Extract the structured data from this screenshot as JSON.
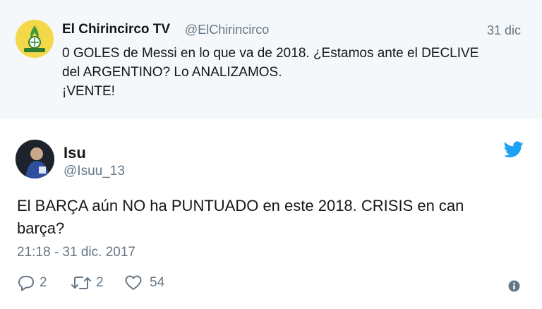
{
  "parent_tweet": {
    "author_name": "El Chirincirco TV",
    "author_handle": "@ElChirincirco",
    "date": "31 dic",
    "text_lines": [
      "0 GOLES de Messi en lo que va de 2018. ¿Estamos ante el DECLIVE",
      "del ARGENTINO? Lo ANALIZAMOS.",
      "¡VENTE!"
    ],
    "avatar_icon": "chiringuito-logo-icon"
  },
  "reply_tweet": {
    "author_name": "Isu",
    "author_handle": "@Isuu_13",
    "text_lines": [
      "El BARÇA aún NO ha PUNTUADO en este 2018. CRISIS en can",
      "barça?"
    ],
    "timestamp": "21:18 - 31 dic. 2017",
    "actions": {
      "reply_count": "2",
      "retweet_count": "2",
      "like_count": "54"
    },
    "brand_icon": "twitter-bird-icon"
  },
  "colors": {
    "parent_background": "#f5f8fa",
    "secondary_text": "#657786",
    "twitter_blue": "#1da1f2",
    "primary_text": "#14171a"
  }
}
